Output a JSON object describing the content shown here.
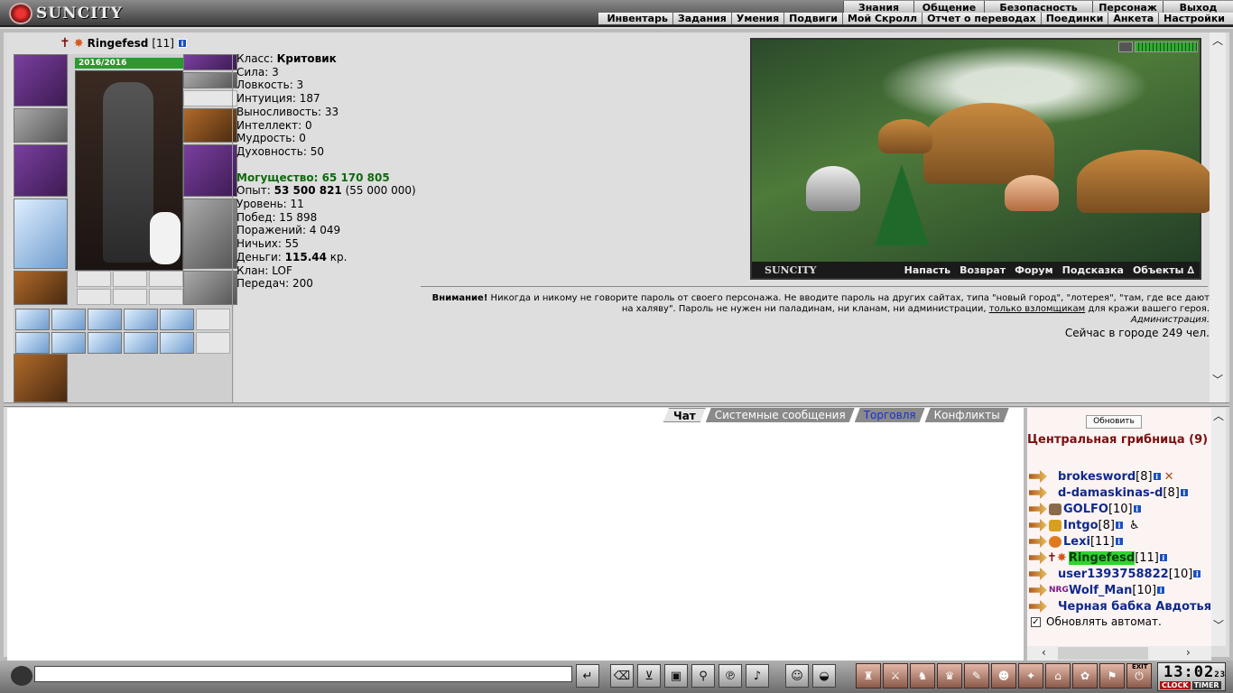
{
  "header": {
    "logo_text": "SUNCITY",
    "top_menu": [
      "Знания",
      "Общение",
      "Безопасность",
      "Персонаж",
      "Выход"
    ],
    "sub_menu": [
      "Инвентарь",
      "Задания",
      "Умения",
      "Подвиги",
      "Мой Скролл",
      "Отчет о переводах",
      "Поединки",
      "Анкета",
      "Настройки"
    ]
  },
  "character": {
    "name": "Ringefesd",
    "level": "[11]",
    "hp": "2016/2016",
    "stats": [
      {
        "label": "Класс: ",
        "value": "Критовик",
        "bold": true
      },
      {
        "label": "Сила: ",
        "value": "3"
      },
      {
        "label": "Ловкость: ",
        "value": "3"
      },
      {
        "label": "Интуиция: ",
        "value": "187"
      },
      {
        "label": "Выносливость: ",
        "value": "33"
      },
      {
        "label": "Интеллект: ",
        "value": "0"
      },
      {
        "label": "Мудрость: ",
        "value": "0"
      },
      {
        "label": "Духовность: ",
        "value": "50"
      }
    ],
    "power_label": "Могущество: 65 170 805",
    "exp_label": "Опыт: ",
    "exp_value": "53 500 821",
    "exp_next": " (55 000 000)",
    "level_label": "Уровень: 11",
    "wins": "Побед: 15 898",
    "losses": "Поражений: 4 049",
    "draws": "Ничьих: 55",
    "money_label": "Деньги: ",
    "money_value": "115.44",
    "money_unit": " кр.",
    "clan": "Клан: LOF",
    "transfers": "Передач: 200"
  },
  "banner": {
    "logo": "SUNCITY",
    "links": [
      "Напасть",
      "Возврат",
      "Форум",
      "Подсказка",
      "Объекты ∆"
    ]
  },
  "warning": {
    "bold": "Внимание!",
    "text1": " Никогда и никому не говорите пароль от своего персонажа. Не вводите пароль на других сайтах, типа \"новый город\", \"лотерея\", \"там, где все дают на халяву\". Пароль не нужен ни паладинам, ни кланам, ни администрации, ",
    "link": "только взломщикам",
    "text2": " для кражи вашего героя.",
    "signature": "Администрация."
  },
  "online": "Сейчас в городе 249 чел.",
  "chat_tabs": [
    "Чат",
    "Системные сообщения",
    "Торговля",
    "Конфликты"
  ],
  "sidebar": {
    "refresh_label": "Обновить",
    "room_title": "Центральная грибница (9)",
    "auto_refresh": "Обновлять автомат.",
    "players": [
      {
        "name": "brokesword",
        "level": "[8]"
      },
      {
        "name": "d-damaskinas-d",
        "level": "[8]"
      },
      {
        "name": "GOLFO",
        "level": "[10]"
      },
      {
        "name": "Intgo",
        "level": "[8]"
      },
      {
        "name": "Lexi",
        "level": "[11]"
      },
      {
        "name": "Ringefesd",
        "level": "[11]"
      },
      {
        "name": "user1393758822",
        "level": "[10]"
      },
      {
        "name": "Wolf_Man",
        "level": "[10]"
      },
      {
        "name": "Черная бабка Авдотья",
        "level": ""
      }
    ],
    "clan_tag": "NRG"
  },
  "clock": {
    "time": "13:02",
    "seconds": "23",
    "clock_label": "CLOCK",
    "timer_label": "TIMER",
    "exit_label": "EXIT"
  },
  "colors": {
    "power": "#0d6b0d",
    "room": "#7a1010",
    "player": "#102a8a",
    "highlight": "#2ed42e"
  }
}
